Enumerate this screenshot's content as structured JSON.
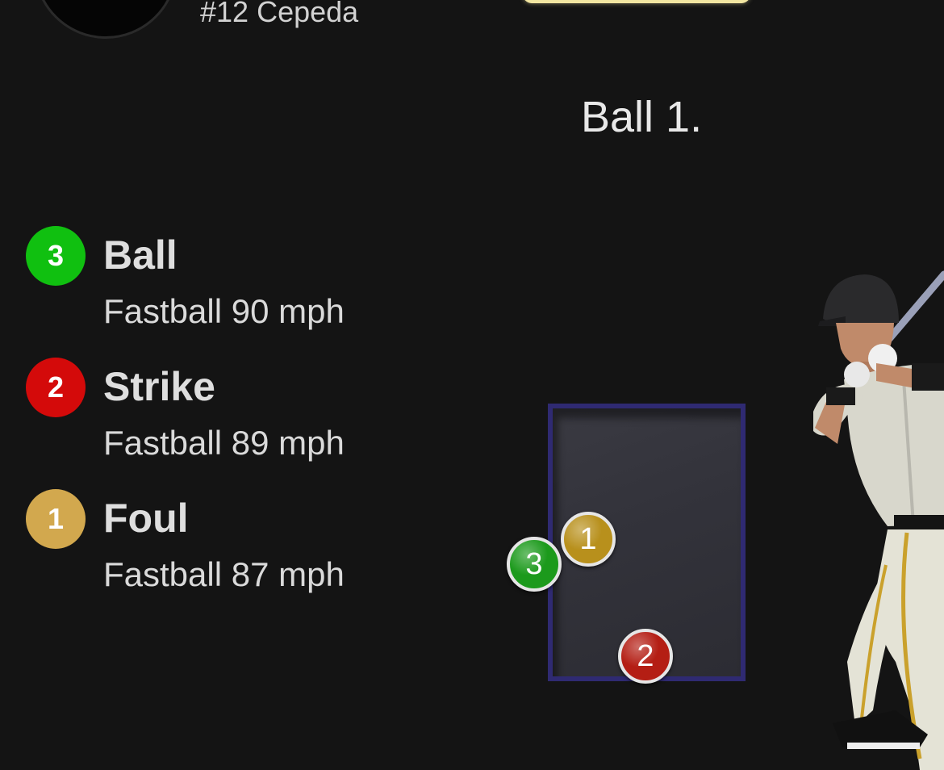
{
  "header": {
    "batter_number": "#12 Cepeda"
  },
  "result": {
    "text": "Ball 1."
  },
  "pitches": [
    {
      "number": "3",
      "outcome": "Ball",
      "detail": "Fastball 90 mph",
      "color": "#10c010"
    },
    {
      "number": "2",
      "outcome": "Strike",
      "detail": "Fastball 89 mph",
      "color": "#d40a0a"
    },
    {
      "number": "1",
      "outcome": "Foul",
      "detail": "Fastball 87 mph",
      "color": "#d2a84e"
    }
  ],
  "zone_markers": [
    {
      "number": "1",
      "color": "#b8901c"
    },
    {
      "number": "3",
      "color": "#1c9a1c"
    },
    {
      "number": "2",
      "color": "#b41e14"
    }
  ],
  "colors": {
    "background": "#141414",
    "strike_zone_border": "#2f2a72",
    "banner": "#f2e6a1"
  },
  "icons": {
    "avatar": "batter-avatar",
    "batter": "batter-figure"
  }
}
